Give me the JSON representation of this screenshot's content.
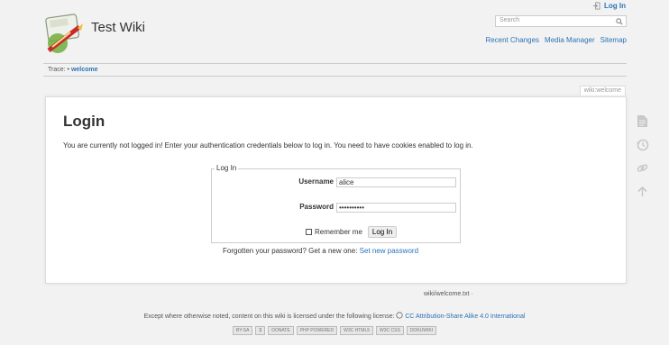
{
  "header": {
    "site_title": "Test Wiki",
    "login_label": "Log In",
    "search_placeholder": "Search",
    "site_tools": [
      "Recent Changes",
      "Media Manager",
      "Sitemap"
    ]
  },
  "breadcrumb": {
    "label": "Trace:",
    "separator": "•",
    "current": "welcome"
  },
  "page_id": "wiki:welcome",
  "login": {
    "title": "Login",
    "intro": "You are currently not logged in! Enter your authentication credentials below to log in. You need to have cookies enabled to log in.",
    "legend": "Log In",
    "username_label": "Username",
    "username_value": "alice",
    "password_label": "Password",
    "password_value": "••••••••••",
    "remember_label": "Remember me",
    "remember_checked": false,
    "submit_label": "Log In",
    "forgot_text": "Forgotten your password? Get a new one:",
    "forgot_link": "Set new password"
  },
  "page_tools": [
    "show-page-icon",
    "old-revisions-icon",
    "backlinks-icon",
    "back-to-top-icon"
  ],
  "doc_info": "wiki/welcome.txt ·",
  "footer": {
    "license_text": "Except where otherwise noted, content on this wiki is licensed under the following license:",
    "license_link": "CC Attribution-Share Alike 4.0 International",
    "badges": [
      "BY-SA",
      "$",
      "DONATE",
      "PHP POWERED",
      "W3C HTML5",
      "W3C CSS",
      "DOKUWIKI"
    ]
  }
}
